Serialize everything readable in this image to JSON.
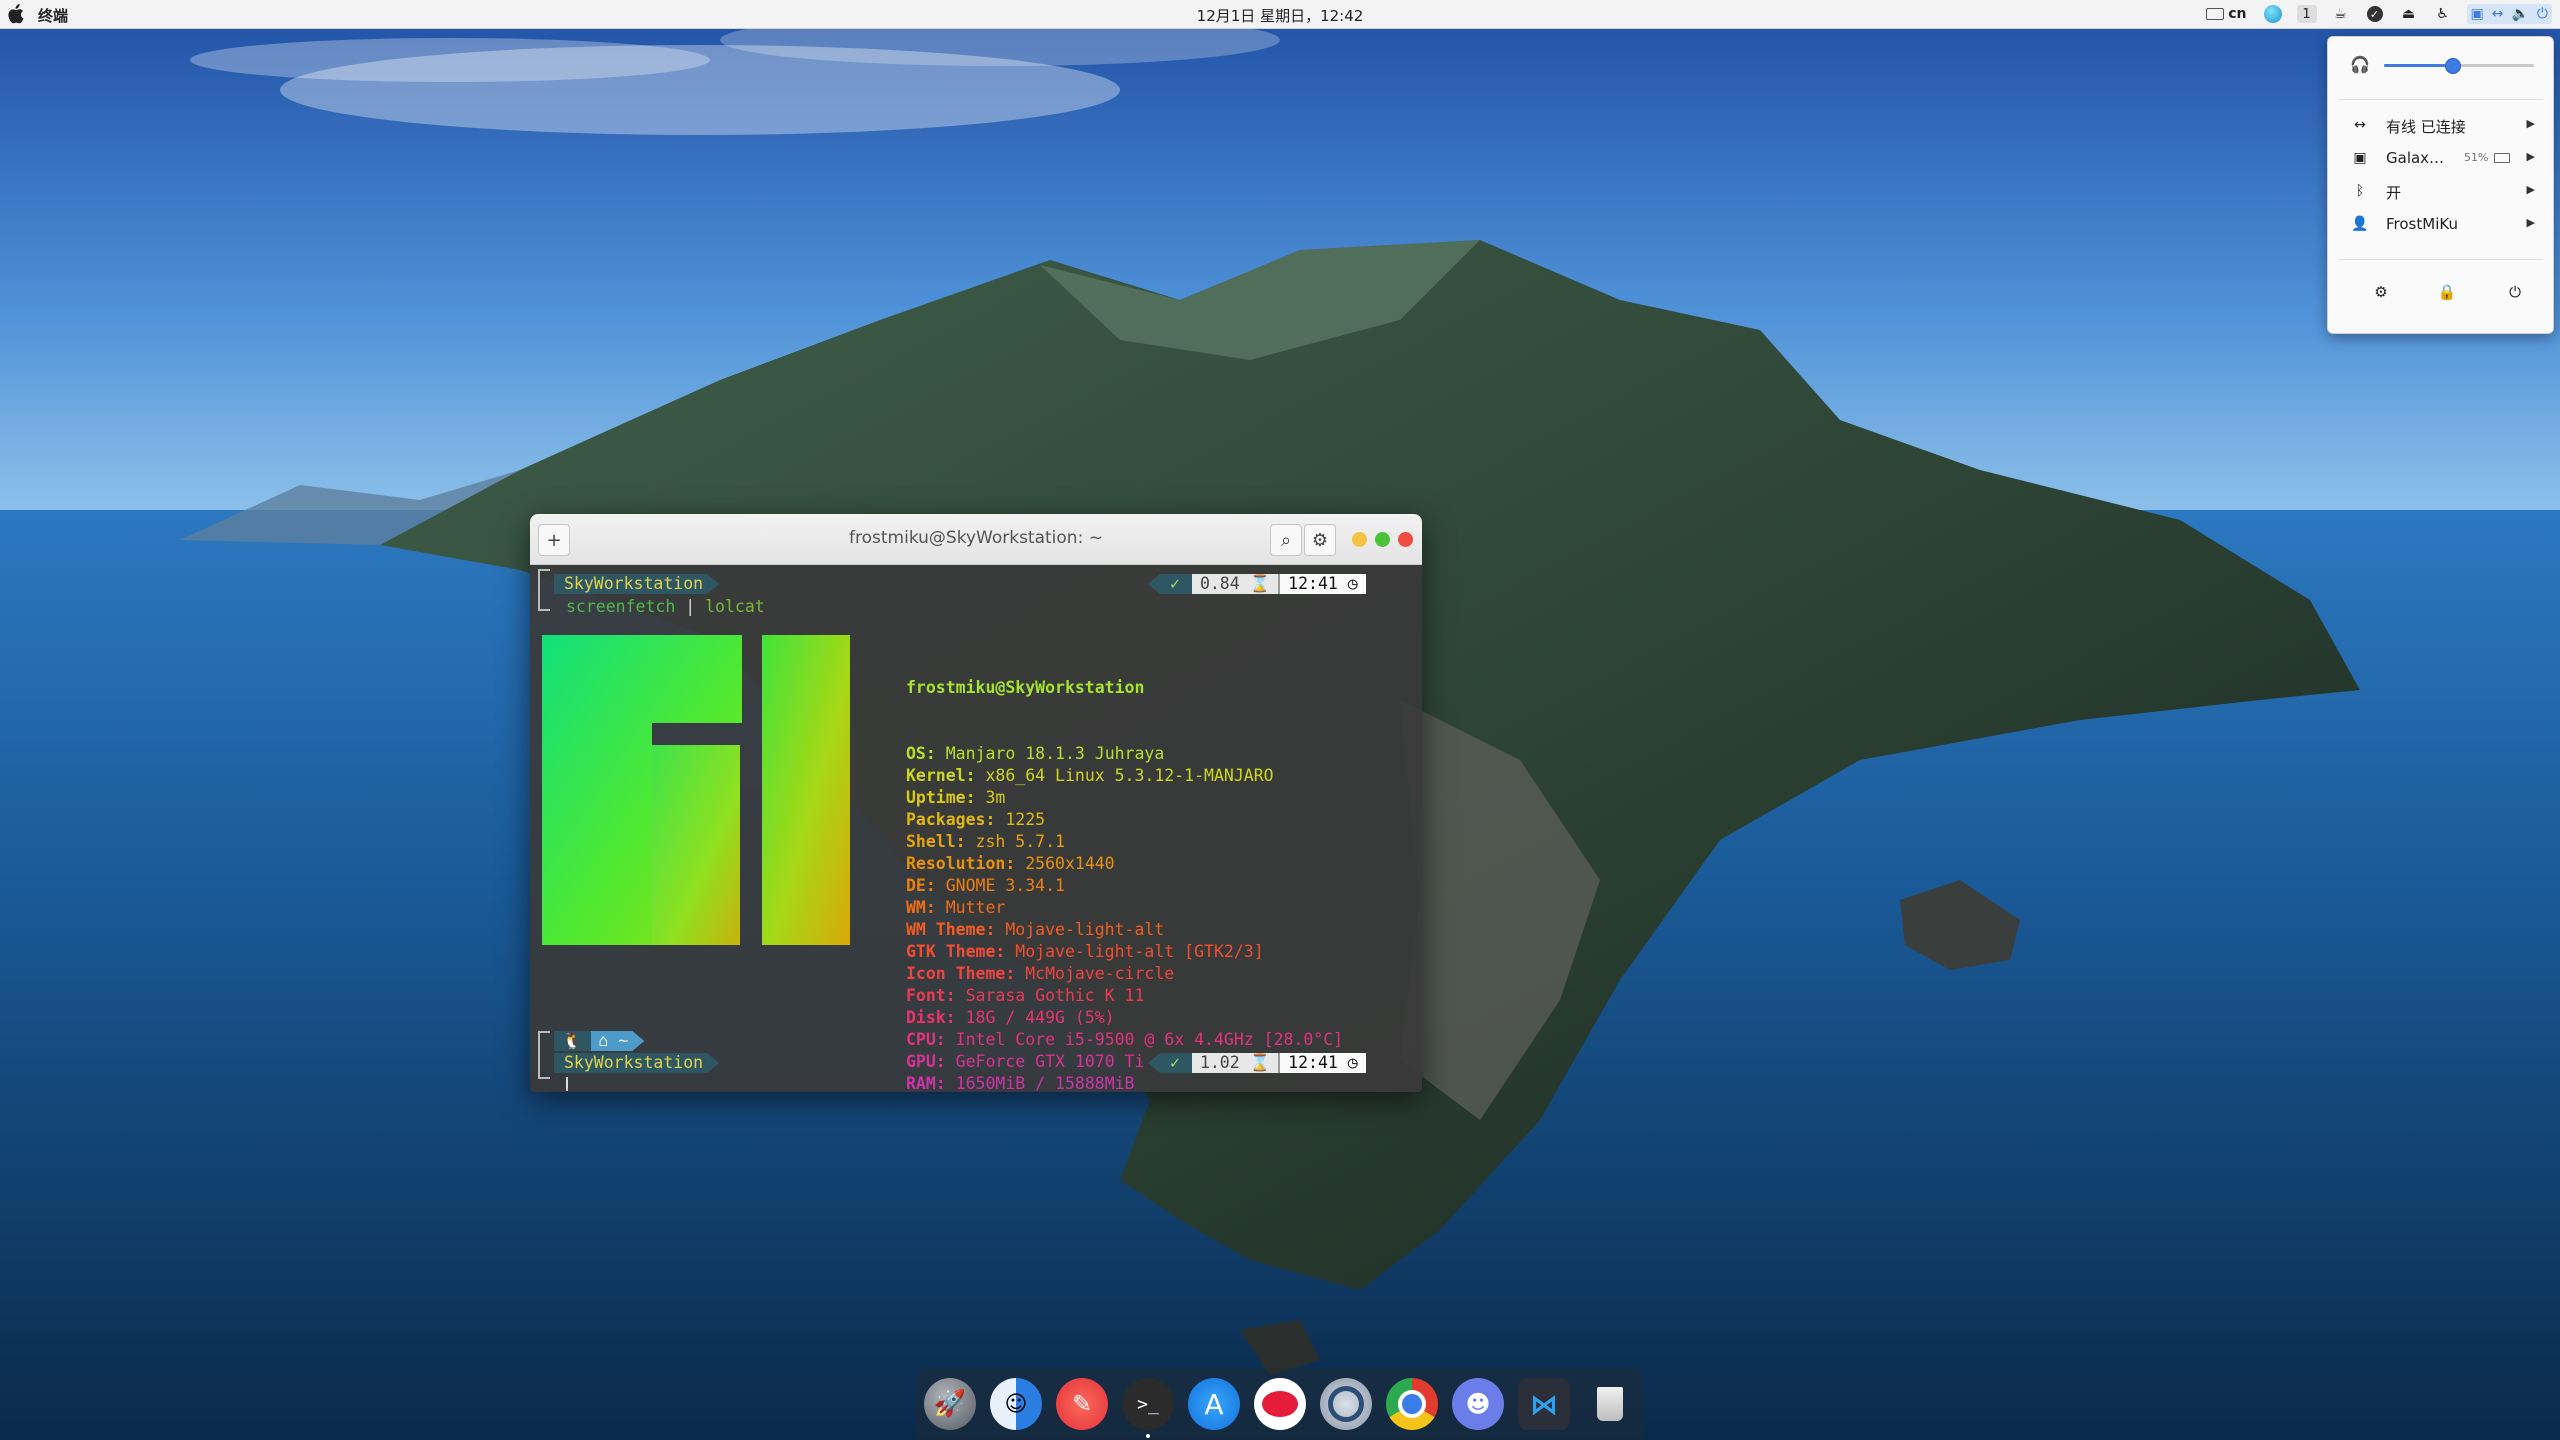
{
  "topbar": {
    "app_name": "终端",
    "clock": "12月1日 星期日，12:42",
    "lang": "cn",
    "workspace": "1"
  },
  "system_menu": {
    "volume_fraction": 0.45,
    "items": [
      {
        "label": "有线 已连接",
        "sub": ""
      },
      {
        "label": "Galax…",
        "sub": "51%"
      },
      {
        "label": "开",
        "sub": ""
      },
      {
        "label": "FrostMiKu",
        "sub": ""
      }
    ]
  },
  "terminal": {
    "title": "frostmiku@SkyWorkstation: ~",
    "prompt1": {
      "host": "SkyWorkstation",
      "check": "✓",
      "load": "0.84",
      "time": "12:41"
    },
    "command": {
      "part1": "screenfetch",
      "pipe": "|",
      "part2": "lolcat"
    },
    "user_line": "frostmiku@SkyWorkstation",
    "info": [
      {
        "key": "OS:",
        "value": " Manjaro 18.1.3 Juhraya"
      },
      {
        "key": "Kernel:",
        "value": " x86_64 Linux 5.3.12-1-MANJARO"
      },
      {
        "key": "Uptime:",
        "value": " 3m"
      },
      {
        "key": "Packages:",
        "value": " 1225"
      },
      {
        "key": "Shell:",
        "value": " zsh 5.7.1"
      },
      {
        "key": "Resolution:",
        "value": " 2560x1440"
      },
      {
        "key": "DE:",
        "value": " GNOME 3.34.1"
      },
      {
        "key": "WM:",
        "value": " Mutter"
      },
      {
        "key": "WM Theme:",
        "value": " Mojave-light-alt"
      },
      {
        "key": "GTK Theme:",
        "value": " Mojave-light-alt [GTK2/3]"
      },
      {
        "key": "Icon Theme:",
        "value": " McMojave-circle"
      },
      {
        "key": "Font:",
        "value": " Sarasa Gothic K 11"
      },
      {
        "key": "Disk:",
        "value": " 18G / 449G (5%)"
      },
      {
        "key": "CPU:",
        "value": " Intel Core i5-9500 @ 6x 4.4GHz [28.0°C]"
      },
      {
        "key": "GPU:",
        "value": " GeForce GTX 1070 Ti"
      },
      {
        "key": "RAM:",
        "value": " 1650MiB / 15888MiB"
      }
    ],
    "prompt2": {
      "dir": "~",
      "host": "SkyWorkstation",
      "check": "✓",
      "load": "1.02",
      "time": "12:41"
    }
  },
  "dock": {
    "apps": [
      "launchpad-icon",
      "finder-icon",
      "text-editor-icon",
      "terminal-icon",
      "app-store-icon",
      "bubble-chat-icon",
      "screenshot-icon",
      "chrome-icon",
      "discord-icon",
      "vscode-icon",
      "trash-icon"
    ]
  },
  "colors": {
    "accent": "#3e7be5",
    "host_segment": "#2f5763",
    "host_text": "#e0d44a"
  }
}
